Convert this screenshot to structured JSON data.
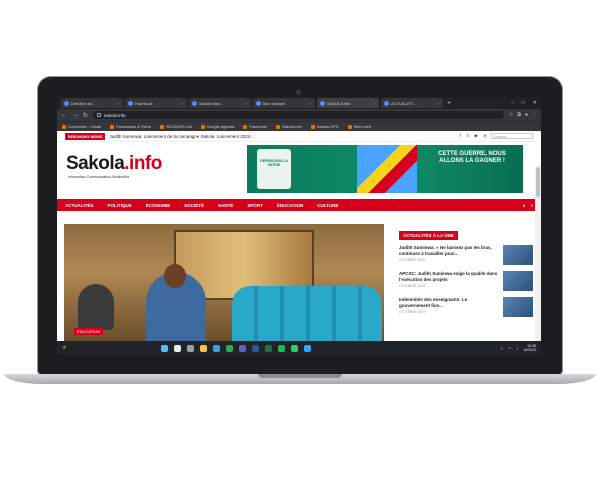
{
  "browser": {
    "tabs": [
      {
        "label": "Direction du ...",
        "active": false
      },
      {
        "label": "Facebook",
        "active": false
      },
      {
        "label": "Sakola Mon...",
        "active": false
      },
      {
        "label": "Mon compte",
        "active": false
      },
      {
        "label": "SAKOLA info",
        "active": true
      },
      {
        "label": "ACTUALITE ...",
        "active": false
      }
    ],
    "url": "sakola.info",
    "bookmarks": [
      "Connexion - Gmail",
      "Formations & Fiche",
      "SEJOURS Uni",
      "Google Agenda",
      "Facebook",
      "Sakola info",
      "Sakola GPS",
      "Sites web"
    ]
  },
  "site": {
    "breaking_label": "BREAKING NEWS",
    "ticker": "Judith Suminwa: Lancement de la campagne Sakola. Lancement 2024...",
    "search_placeholder": "Search",
    "logo_main": "Sakola",
    "logo_accent": ".info",
    "tagline": "Information-Communication-Multimédia",
    "banner": {
      "emblem_text": "DÉFENDONS LA PATRIE",
      "message": "CETTE GUERRE, NOUS ALLONS LA GAGNER !"
    },
    "nav": [
      "ACTUALITÉS",
      "POLITIQUE",
      "ÉCONOMIE",
      "SOCIÉTÉ",
      "SANTÉ",
      "SPORT",
      "ÉDUCATION",
      "CULTURE"
    ],
    "hero_badge": "ÉDUCATION",
    "sidebar": {
      "heading": "ACTUALITÉS À LA UNE",
      "items": [
        {
          "title": "Judith Suminwa: « Ne baissez pas les bras, continuez à travailler pour...",
          "meta": "OCTOBRE 2024"
        },
        {
          "title": "APCSC: Judith Suminwa exige la qualité dans l'exécution des projets",
          "meta": "OCTOBRE 2024"
        },
        {
          "title": "Indemnités des enseignants: Le gouvernement fixe...",
          "meta": "OCTOBRE 2024"
        }
      ]
    }
  },
  "taskbar": {
    "weather": "☀",
    "time": "10:38",
    "date": "10/2024"
  },
  "colors": {
    "brand_red": "#d6001c",
    "banner_green": "#0b7a5b"
  }
}
